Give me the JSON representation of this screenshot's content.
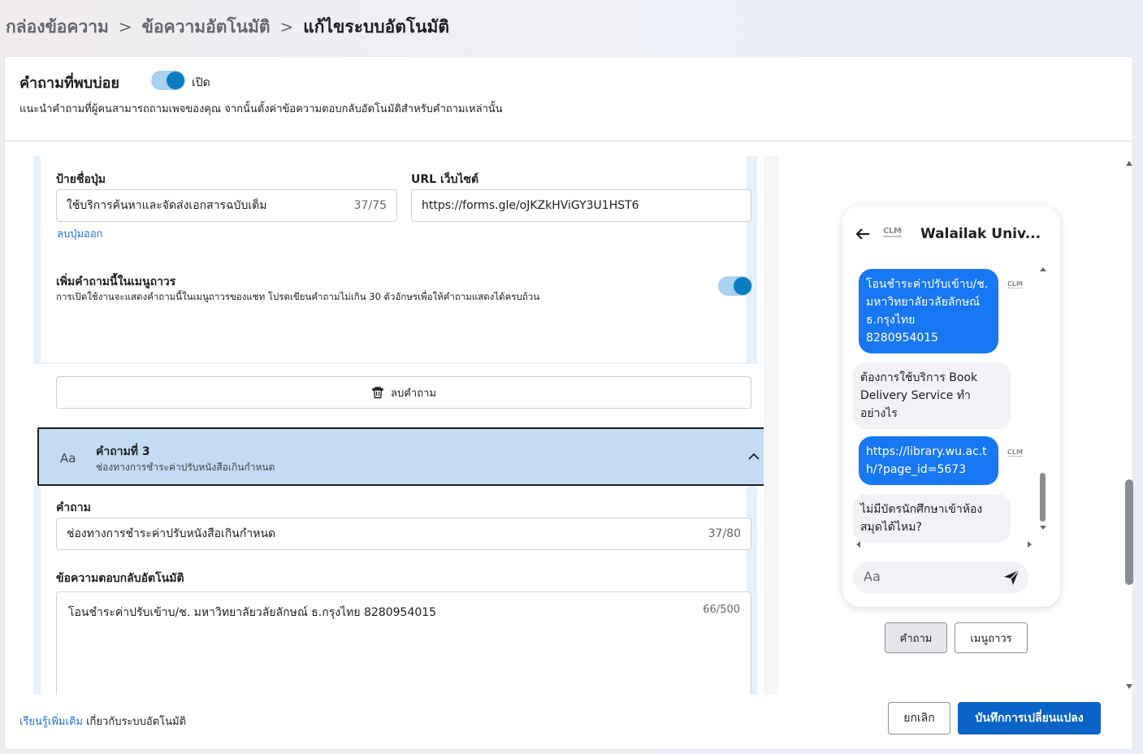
{
  "breadcrumb": {
    "items": [
      "กล่องข้อความ",
      "ข้อความอัตโนมัติ",
      "แก้ไขระบบอัตโนมัติ"
    ],
    "separator": ">"
  },
  "faq": {
    "title": "คำถามที่พบบ่อย",
    "toggle_label": "เปิด",
    "toggle_on": true,
    "description": "แนะนำคำถามที่ผู้คนสามารถถามเพจของคุณ จากนั้นตั้งค่าข้อความตอบกลับอัตโนมัติสำหรับคำถามเหล่านั้น"
  },
  "button_section": {
    "button_label_title": "ป้ายชื่อปุ่ม",
    "button_label_value": "ใช้บริการค้นหาและจัดส่งเอกสารฉบับเต็ม",
    "button_label_counter": "37/75",
    "url_title": "URL เว็บไซต์",
    "url_value": "https://forms.gle/oJKZkHViGY3U1HST6",
    "remove_button_link": "ลบปุ่มออก"
  },
  "persistent_menu": {
    "title": "เพิ่มคำถามนี้ในเมนูถาวร",
    "description": "การเปิดใช้งานจะแสดงคำถามนี้ในเมนูถาวรของแชท โปรดเขียนคำถามไม่เกิน 30 ตัวอักษรเพื่อให้คำถามแสดงได้ครบถ้วน",
    "toggle_on": true
  },
  "delete_question": "ลบคำถาม",
  "question3": {
    "icon_text": "Aa",
    "title": "คำถามที่ 3",
    "subtitle": "ช่องทางการชำระค่าปรับหนังสือเกินกำหนด",
    "question_label": "คำถาม",
    "question_value": "ช่องทางการชำระค่าปรับหนังสือเกินกำหนด",
    "question_counter": "37/80",
    "reply_label": "ข้อความตอบกลับอัตโนมัติ",
    "reply_value": "โอนชำระค่าปรับเข้าบ/ช. มหาวิทยาลัยวลัยลักษณ์  ธ.กรุงไทย 8280954015",
    "reply_counter": "66/500"
  },
  "preview": {
    "page_name": "Walailak Univ...",
    "logo_text": "CLM",
    "messages": [
      {
        "from": "page",
        "lines": [
          "โอนชำระค่าปรับเข้าบ/ช.",
          "มหาวิทยาลัยวลัยลักษณ์",
          "ธ.กรุงไทย",
          "8280954015"
        ]
      },
      {
        "from": "user",
        "lines": [
          "ต้องการใช้บริการ Book",
          "Delivery Service ทำ",
          "อย่างไร"
        ]
      },
      {
        "from": "page",
        "lines": [
          "https://library.wu.ac.t",
          "h/?page_id=5673"
        ]
      },
      {
        "from": "user",
        "lines": [
          "ไม่มีบัตรนักศึกษาเข้าห้อง",
          "สมุดได้ไหม?"
        ]
      }
    ],
    "compose_placeholder": "Aa",
    "tabs": [
      "คำถาม",
      "เมนูถาวร"
    ],
    "active_tab": 0
  },
  "footer": {
    "learn_more_link": "เรียนรู้เพิ่มเติม",
    "learn_more_text": " เกี่ยวกับระบบอัตโนมัติ",
    "cancel": "ยกเลิก",
    "save": "บันทึกการเปลี่ยนแปลง"
  },
  "colors": {
    "accent": "#0a7cc2",
    "primary_button": "#0a63c7",
    "link": "#216fdb",
    "messenger_blue": "#1877f2",
    "panel_bg": "#e7f1fb",
    "selected_header": "#c3dbf3"
  }
}
